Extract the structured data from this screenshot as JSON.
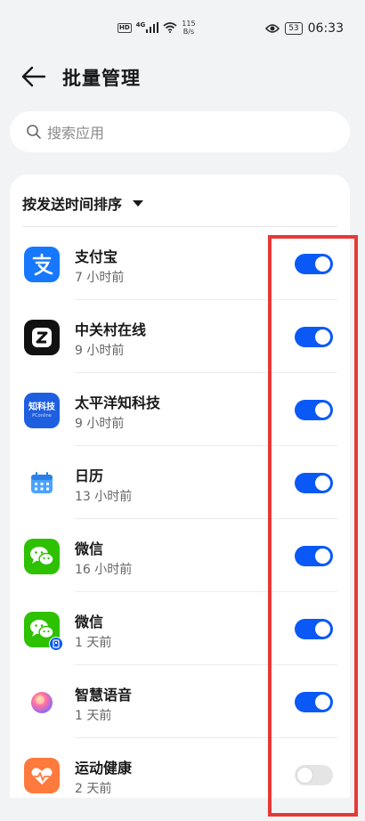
{
  "status_bar": {
    "hd": "HD",
    "network": "4G",
    "speed_value": "115",
    "speed_unit": "B/s",
    "battery": "53",
    "time": "06:33"
  },
  "header": {
    "title": "批量管理"
  },
  "search": {
    "placeholder": "搜索应用"
  },
  "sort": {
    "label": "按发送时间排序"
  },
  "apps": [
    {
      "name": "支付宝",
      "time": "7 小时前",
      "icon": "alipay-icon",
      "enabled": true
    },
    {
      "name": "中关村在线",
      "time": "9 小时前",
      "icon": "zol-icon",
      "enabled": true
    },
    {
      "name": "太平洋知科技",
      "time": "9 小时前",
      "icon": "pconline-icon",
      "icon_text": "知科技",
      "icon_subtext": "PConline",
      "enabled": true
    },
    {
      "name": "日历",
      "time": "13 小时前",
      "icon": "calendar-icon",
      "enabled": true
    },
    {
      "name": "微信",
      "time": "16 小时前",
      "icon": "wechat-icon",
      "enabled": true
    },
    {
      "name": "微信",
      "time": "1 天前",
      "icon": "wechat-clone-icon",
      "enabled": true
    },
    {
      "name": "智慧语音",
      "time": "1 天前",
      "icon": "voice-assistant-icon",
      "enabled": true
    },
    {
      "name": "运动健康",
      "time": "2 天前",
      "icon": "health-icon",
      "enabled": false
    }
  ],
  "colors": {
    "toggle_on": "#0a59f7",
    "toggle_off": "#e5e5e5",
    "highlight": "#e53935"
  }
}
